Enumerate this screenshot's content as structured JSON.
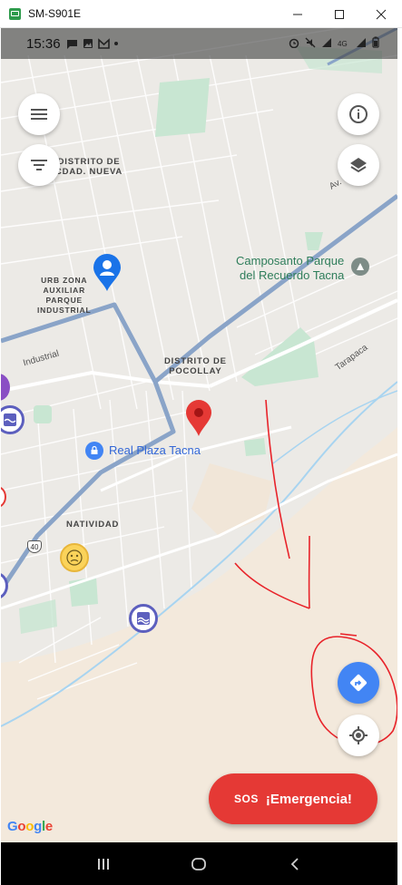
{
  "window": {
    "title": "SM-S901E",
    "minimize_icon": "minimize-icon",
    "maximize_icon": "maximize-icon",
    "close_icon": "close-icon"
  },
  "status_bar": {
    "time": "15:36",
    "right_icons": [
      "alarm-icon",
      "mute-icon",
      "signal-icon",
      "volte-4g-icon",
      "signal-icon",
      "battery-icon"
    ]
  },
  "map": {
    "labels": {
      "distrito_nueva_line1": "DISTRITO DE",
      "distrito_nueva_line2": "CDAD. NUEVA",
      "urb_line1": "URB ZONA",
      "urb_line2": "AUXILIAR",
      "urb_line3": "PARQUE",
      "urb_line4": "INDUSTRIAL",
      "pocollay_line1": "DISTRITO DE",
      "pocollay_line2": "POCOLLAY",
      "natividad": "NATIVIDAD",
      "camposanto_line1": "Camposanto Parque",
      "camposanto_line2": "del Recuerdo Tacna",
      "real_plaza": "Real Plaza Tacna",
      "road_industrial": "Industrial",
      "road_tarapaca": "Tarapaca",
      "road_av": "Av.",
      "route_shield": "40"
    },
    "colors": {
      "map_bg": "#eceae6",
      "park": "#c8e6d2",
      "desert": "#f3e9dc",
      "major_road": "#8aa4c8",
      "river": "#a8d4f0",
      "annotation": "#e8232a",
      "accent_blue": "#4285f4",
      "sos_red": "#e53935"
    }
  },
  "controls": {
    "menu_icon": "hamburger-menu-icon",
    "filter_icon": "filter-icon",
    "info_icon": "info-icon",
    "layers_icon": "layers-icon",
    "directions_icon": "directions-icon",
    "my_location_icon": "my-location-icon"
  },
  "sos": {
    "icon_text": "SOS",
    "label": "¡Emergencia!"
  },
  "google": {
    "logo_text": "Google"
  },
  "nav_bar": {
    "recents_icon": "recents-icon",
    "home_icon": "home-icon",
    "back_icon": "back-icon"
  }
}
